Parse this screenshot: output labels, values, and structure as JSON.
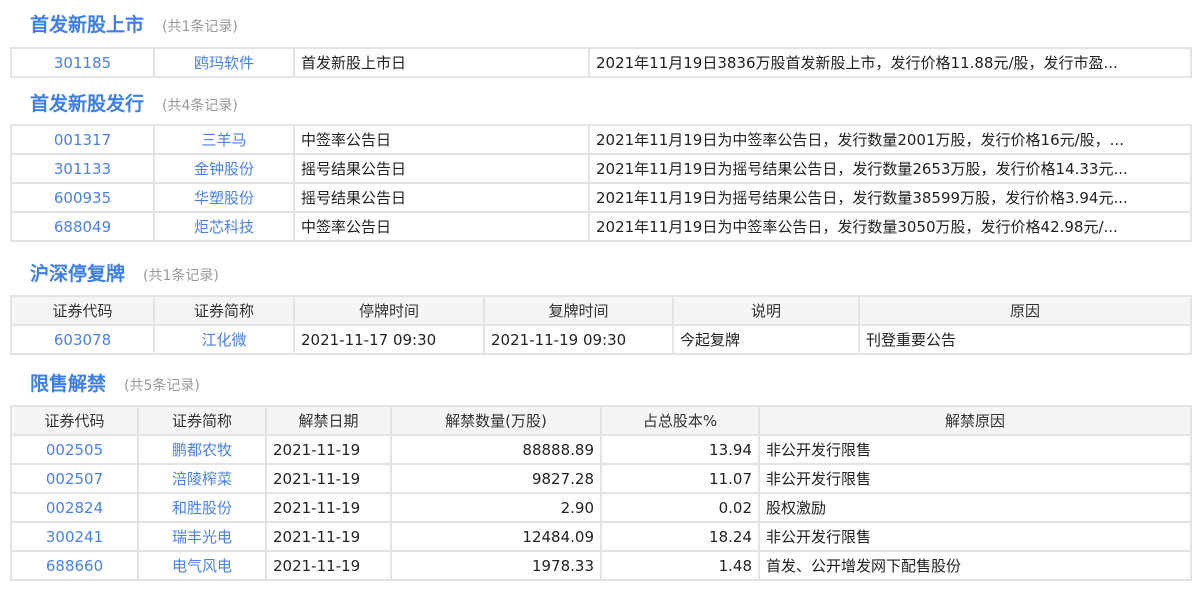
{
  "sections": [
    {
      "title": "首发新股上市",
      "count": "(共1条记录)",
      "headers": [],
      "cols": [
        143,
        140,
        295,
        602
      ],
      "align": [
        "link",
        "link",
        "",
        ""
      ],
      "rows": [
        [
          "301185",
          "鸥玛软件",
          "首发新股上市日",
          "2021年11月19日3836万股首发新股上市，发行价格11.88元/股，发行市盈..."
        ]
      ]
    },
    {
      "title": "首发新股发行",
      "count": "(共4条记录)",
      "headers": [],
      "cols": [
        143,
        140,
        295,
        602
      ],
      "align": [
        "link",
        "link",
        "",
        ""
      ],
      "rows": [
        [
          "001317",
          "三羊马",
          "中签率公告日",
          "2021年11月19日为中签率公告日，发行数量2001万股，发行价格16元/股，..."
        ],
        [
          "301133",
          "金钟股份",
          "摇号结果公告日",
          "2021年11月19日为摇号结果公告日，发行数量2653万股，发行价格14.33元..."
        ],
        [
          "600935",
          "华塑股份",
          "摇号结果公告日",
          "2021年11月19日为摇号结果公告日，发行数量38599万股，发行价格3.94元..."
        ],
        [
          "688049",
          "炬芯科技",
          "中签率公告日",
          "2021年11月19日为中签率公告日，发行数量3050万股，发行价格42.98元/..."
        ]
      ]
    },
    {
      "title": "沪深停复牌",
      "count": "(共1条记录)",
      "headers": [
        "证券代码",
        "证券简称",
        "停牌时间",
        "复牌时间",
        "说明",
        "原因"
      ],
      "cols": [
        143,
        140,
        190,
        189,
        186,
        332
      ],
      "align": [
        "link",
        "link",
        "",
        "",
        "",
        ""
      ],
      "rows": [
        [
          "603078",
          "江化微",
          "2021-11-17 09:30",
          "2021-11-19 09:30",
          "今起复牌",
          "刊登重要公告"
        ]
      ]
    },
    {
      "title": "限售解禁",
      "count": "(共5条记录)",
      "headers": [
        "证券代码",
        "证券简称",
        "解禁日期",
        "解禁数量(万股)",
        "占总股本%",
        "解禁原因"
      ],
      "cols": [
        127,
        128,
        125,
        210,
        158,
        432
      ],
      "align": [
        "link",
        "link",
        "",
        "num",
        "num",
        ""
      ],
      "rows": [
        [
          "002505",
          "鹏都农牧",
          "2021-11-19",
          "88888.89",
          "13.94",
          "非公开发行限售"
        ],
        [
          "002507",
          "涪陵榨菜",
          "2021-11-19",
          "9827.28",
          "11.07",
          "非公开发行限售"
        ],
        [
          "002824",
          "和胜股份",
          "2021-11-19",
          "2.90",
          "0.02",
          "股权激励"
        ],
        [
          "300241",
          "瑞丰光电",
          "2021-11-19",
          "12484.09",
          "18.24",
          "非公开发行限售"
        ],
        [
          "688660",
          "电气风电",
          "2021-11-19",
          "1978.33",
          "1.48",
          "首发、公开增发网下配售股份"
        ]
      ]
    }
  ]
}
